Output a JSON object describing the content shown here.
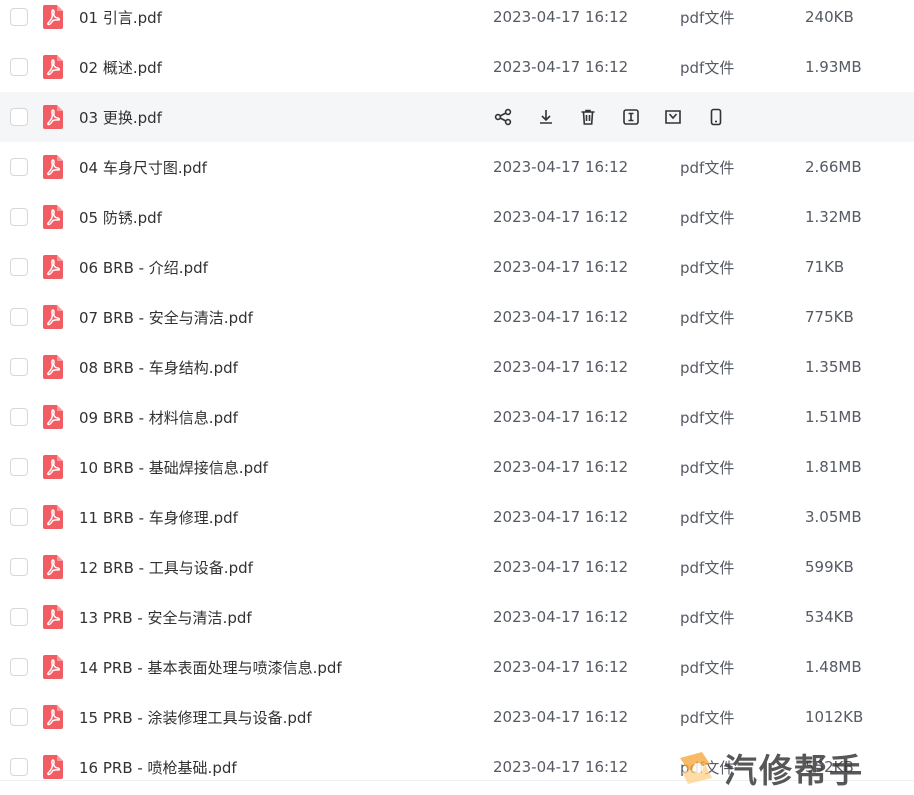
{
  "files": [
    {
      "name": "01 引言.pdf",
      "date": "2023-04-17 16:12",
      "type": "pdf文件",
      "size": "240KB"
    },
    {
      "name": "02 概述.pdf",
      "date": "2023-04-17 16:12",
      "type": "pdf文件",
      "size": "1.93MB"
    },
    {
      "name": "03 更换.pdf",
      "date": "",
      "type": "",
      "size": "",
      "hovered": true
    },
    {
      "name": "04 车身尺寸图.pdf",
      "date": "2023-04-17 16:12",
      "type": "pdf文件",
      "size": "2.66MB"
    },
    {
      "name": "05 防锈.pdf",
      "date": "2023-04-17 16:12",
      "type": "pdf文件",
      "size": "1.32MB"
    },
    {
      "name": "06 BRB - 介绍.pdf",
      "date": "2023-04-17 16:12",
      "type": "pdf文件",
      "size": "71KB"
    },
    {
      "name": "07 BRB - 安全与清洁.pdf",
      "date": "2023-04-17 16:12",
      "type": "pdf文件",
      "size": "775KB"
    },
    {
      "name": "08 BRB - 车身结构.pdf",
      "date": "2023-04-17 16:12",
      "type": "pdf文件",
      "size": "1.35MB"
    },
    {
      "name": "09 BRB - 材料信息.pdf",
      "date": "2023-04-17 16:12",
      "type": "pdf文件",
      "size": "1.51MB"
    },
    {
      "name": "10 BRB - 基础焊接信息.pdf",
      "date": "2023-04-17 16:12",
      "type": "pdf文件",
      "size": "1.81MB"
    },
    {
      "name": "11 BRB - 车身修理.pdf",
      "date": "2023-04-17 16:12",
      "type": "pdf文件",
      "size": "3.05MB"
    },
    {
      "name": "12 BRB - 工具与设备.pdf",
      "date": "2023-04-17 16:12",
      "type": "pdf文件",
      "size": "599KB"
    },
    {
      "name": "13 PRB - 安全与清洁.pdf",
      "date": "2023-04-17 16:12",
      "type": "pdf文件",
      "size": "534KB"
    },
    {
      "name": "14 PRB - 基本表面处理与喷漆信息.pdf",
      "date": "2023-04-17 16:12",
      "type": "pdf文件",
      "size": "1.48MB"
    },
    {
      "name": "15 PRB - 涂装修理工具与设备.pdf",
      "date": "2023-04-17 16:12",
      "type": "pdf文件",
      "size": "1012KB"
    },
    {
      "name": "16 PRB - 喷枪基础.pdf",
      "date": "2023-04-17 16:12",
      "type": "pdf文件",
      "size": "552KB"
    }
  ],
  "hover_actions": [
    "share-icon",
    "download-icon",
    "delete-icon",
    "rename-icon",
    "move-icon",
    "mobile-icon"
  ],
  "watermark": {
    "text": "汽修帮手"
  },
  "colors": {
    "pdf_icon": "#f25c63",
    "hover_row": "#f5f6f8",
    "checkbox_border": "#d6d8dc"
  }
}
